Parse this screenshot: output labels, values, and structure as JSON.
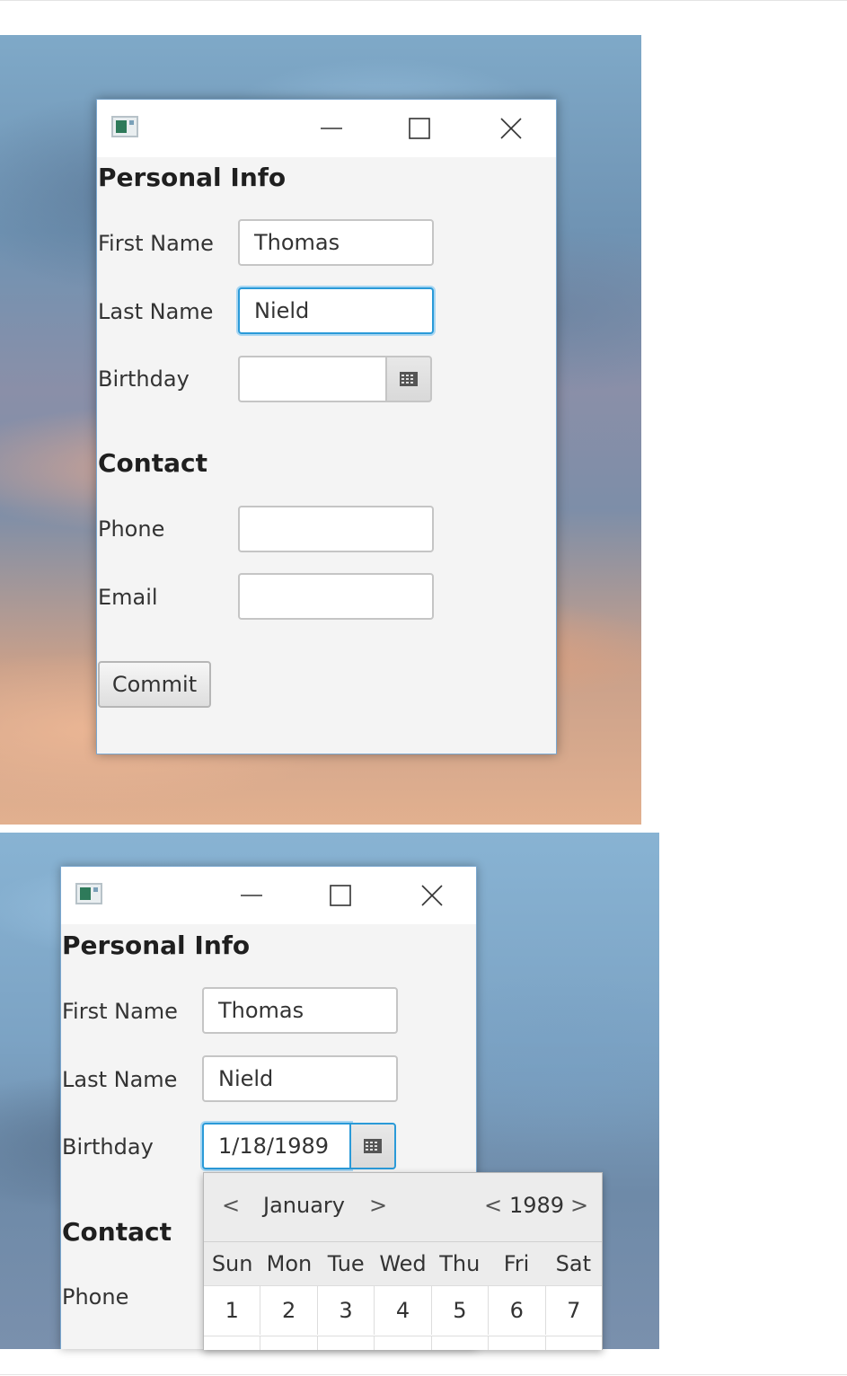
{
  "screens": [
    {
      "form": {
        "personal_title": "Personal Info",
        "first_name_label": "First Name",
        "first_name_value": "Thomas",
        "last_name_label": "Last Name",
        "last_name_value": "Nield",
        "birthday_label": "Birthday",
        "birthday_value": "",
        "contact_title": "Contact",
        "phone_label": "Phone",
        "phone_value": "",
        "email_label": "Email",
        "email_value": "",
        "commit_label": "Commit",
        "focused_field": "last-name"
      }
    },
    {
      "form": {
        "personal_title": "Personal Info",
        "first_name_label": "First Name",
        "first_name_value": "Thomas",
        "last_name_label": "Last Name",
        "last_name_value": "Nield",
        "birthday_label": "Birthday",
        "birthday_value": "1/18/1989",
        "contact_title": "Contact",
        "phone_label": "Phone",
        "focused_field": "birthday"
      },
      "date_picker": {
        "month_prev": "<",
        "month": "January",
        "month_next": ">",
        "year_prev": "<",
        "year": "1989",
        "year_next": ">",
        "weekdays": [
          "Sun",
          "Mon",
          "Tue",
          "Wed",
          "Thu",
          "Fri",
          "Sat"
        ],
        "first_week": [
          "1",
          "2",
          "3",
          "4",
          "5",
          "6",
          "7"
        ]
      }
    }
  ],
  "colors": {
    "focus_border": "#2a9ad8",
    "window_bg": "#f4f4f4",
    "titlebar_bg": "#ffffff"
  },
  "icons": [
    "app-icon",
    "minimize-icon",
    "maximize-icon",
    "close-icon",
    "calendar-icon"
  ]
}
